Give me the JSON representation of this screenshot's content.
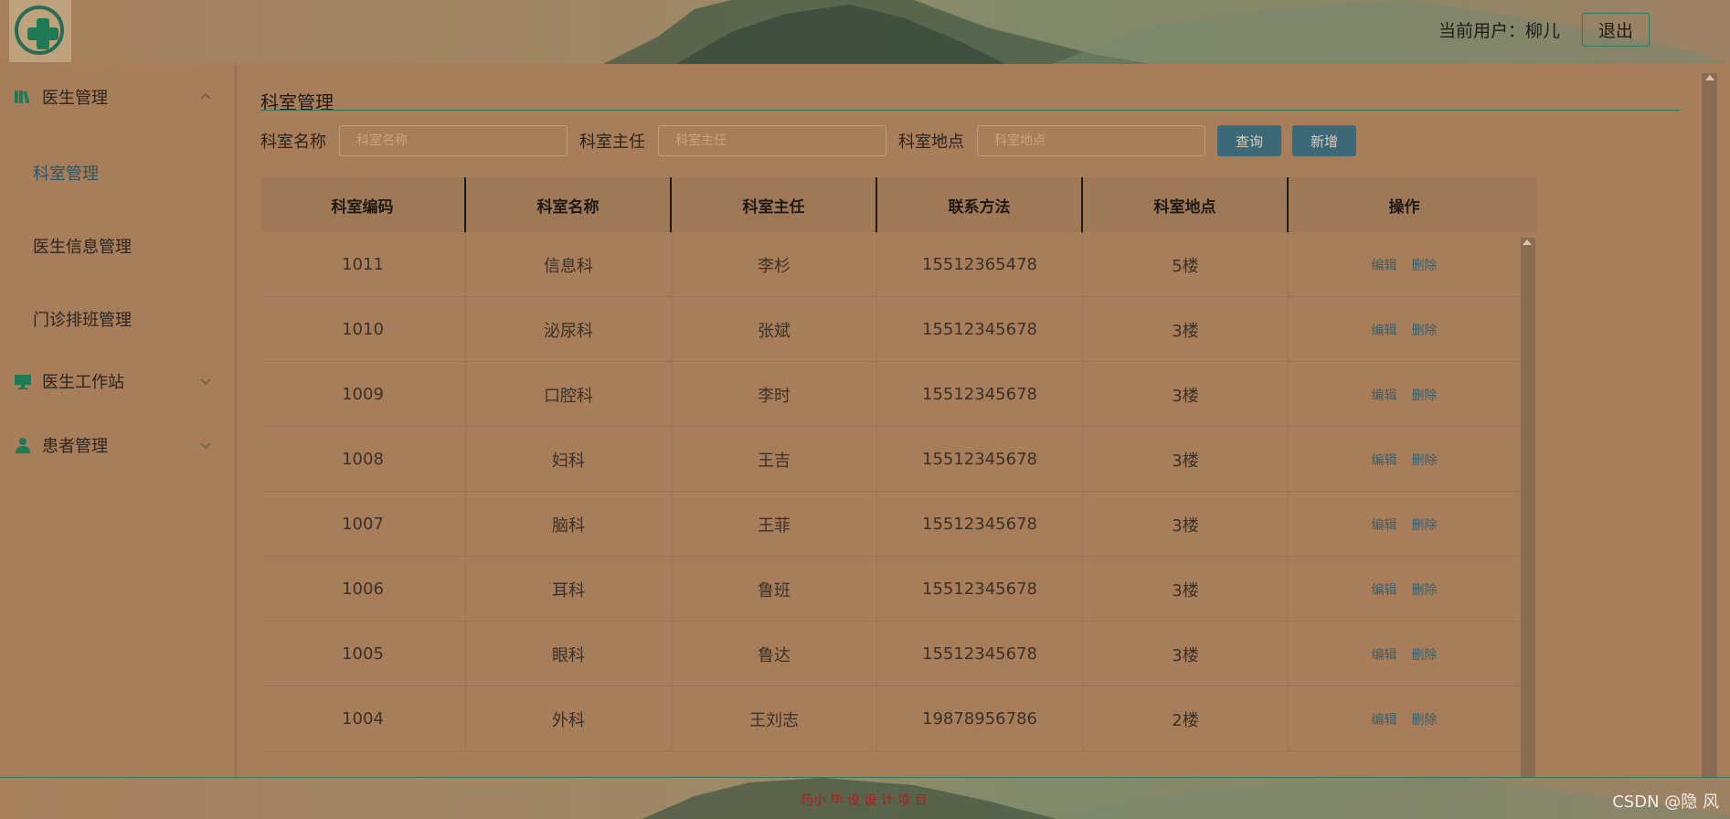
{
  "header": {
    "user_label": "当前用户：柳儿",
    "logout_label": "退出"
  },
  "sidebar": {
    "groups": [
      {
        "label": "医生管理",
        "icon": "books-icon",
        "expanded": true,
        "items": [
          {
            "label": "科室管理",
            "active": true
          },
          {
            "label": "医生信息管理",
            "active": false
          },
          {
            "label": "门诊排班管理",
            "active": false
          }
        ]
      },
      {
        "label": "医生工作站",
        "icon": "monitor-icon",
        "expanded": false
      },
      {
        "label": "患者管理",
        "icon": "user-icon",
        "expanded": false
      }
    ]
  },
  "main": {
    "title": "科室管理",
    "search": {
      "fields": [
        {
          "label": "科室名称",
          "placeholder": "科室名称"
        },
        {
          "label": "科室主任",
          "placeholder": "科室主任"
        },
        {
          "label": "科室地点",
          "placeholder": "科室地点"
        }
      ],
      "query_label": "查询",
      "add_label": "新增"
    },
    "table": {
      "columns": [
        "科室编码",
        "科室名称",
        "科室主任",
        "联系方法",
        "科室地点",
        "操作"
      ],
      "rows": [
        [
          "1011",
          "信息科",
          "李杉",
          "15512365478",
          "5楼"
        ],
        [
          "1010",
          "泌尿科",
          "张斌",
          "15512345678",
          "3楼"
        ],
        [
          "1009",
          "口腔科",
          "李时",
          "15512345678",
          "3楼"
        ],
        [
          "1008",
          "妇科",
          "王吉",
          "15512345678",
          "3楼"
        ],
        [
          "1007",
          "脑科",
          "王菲",
          "15512345678",
          "3楼"
        ],
        [
          "1006",
          "耳科",
          "鲁班",
          "15512345678",
          "3楼"
        ],
        [
          "1005",
          "眼科",
          "鲁达",
          "15512345678",
          "3楼"
        ],
        [
          "1004",
          "外科",
          "王刘志",
          "19878956786",
          "2楼"
        ]
      ],
      "edit_label": "编辑",
      "delete_label": "删除"
    }
  },
  "footer": {
    "text": "药小 毕 设 设 计 项 目",
    "watermark": "CSDN @隐 风"
  },
  "colors": {
    "background": "#a87d59",
    "accent": "#2d7a5a",
    "button": "#3b6a76",
    "footer_text": "#b01e1e"
  }
}
